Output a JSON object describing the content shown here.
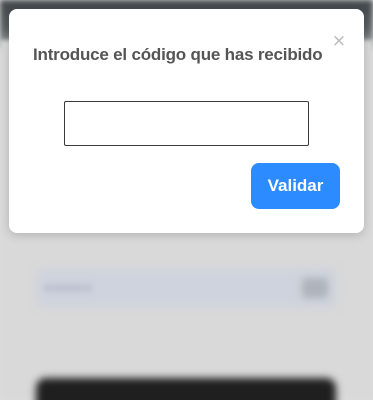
{
  "modal": {
    "title": "Introduce el código que has recibido",
    "close_symbol": "×",
    "close_icon": "close-icon",
    "code_input": {
      "value": "",
      "placeholder": ""
    },
    "validate_label": "Validar"
  },
  "colors": {
    "accent": "#2c8cff",
    "title_text": "#555555",
    "overlay_background": "#dcdcdc"
  }
}
